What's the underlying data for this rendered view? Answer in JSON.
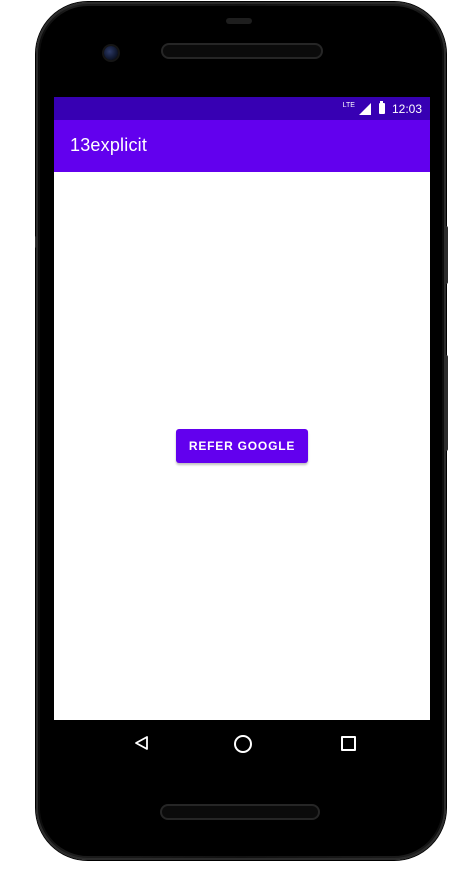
{
  "status_bar": {
    "network_label": "LTE",
    "time": "12:03"
  },
  "app_bar": {
    "title": "13explicit"
  },
  "main": {
    "refer_button_label": "REFER GOOGLE"
  },
  "nav_bar": {
    "back_icon": "back-triangle-icon",
    "home_icon": "home-circle-icon",
    "recents_icon": "recents-square-icon"
  },
  "colors": {
    "status_bar": "#3700b3",
    "app_bar": "#6200ee",
    "button": "#6200ee"
  }
}
